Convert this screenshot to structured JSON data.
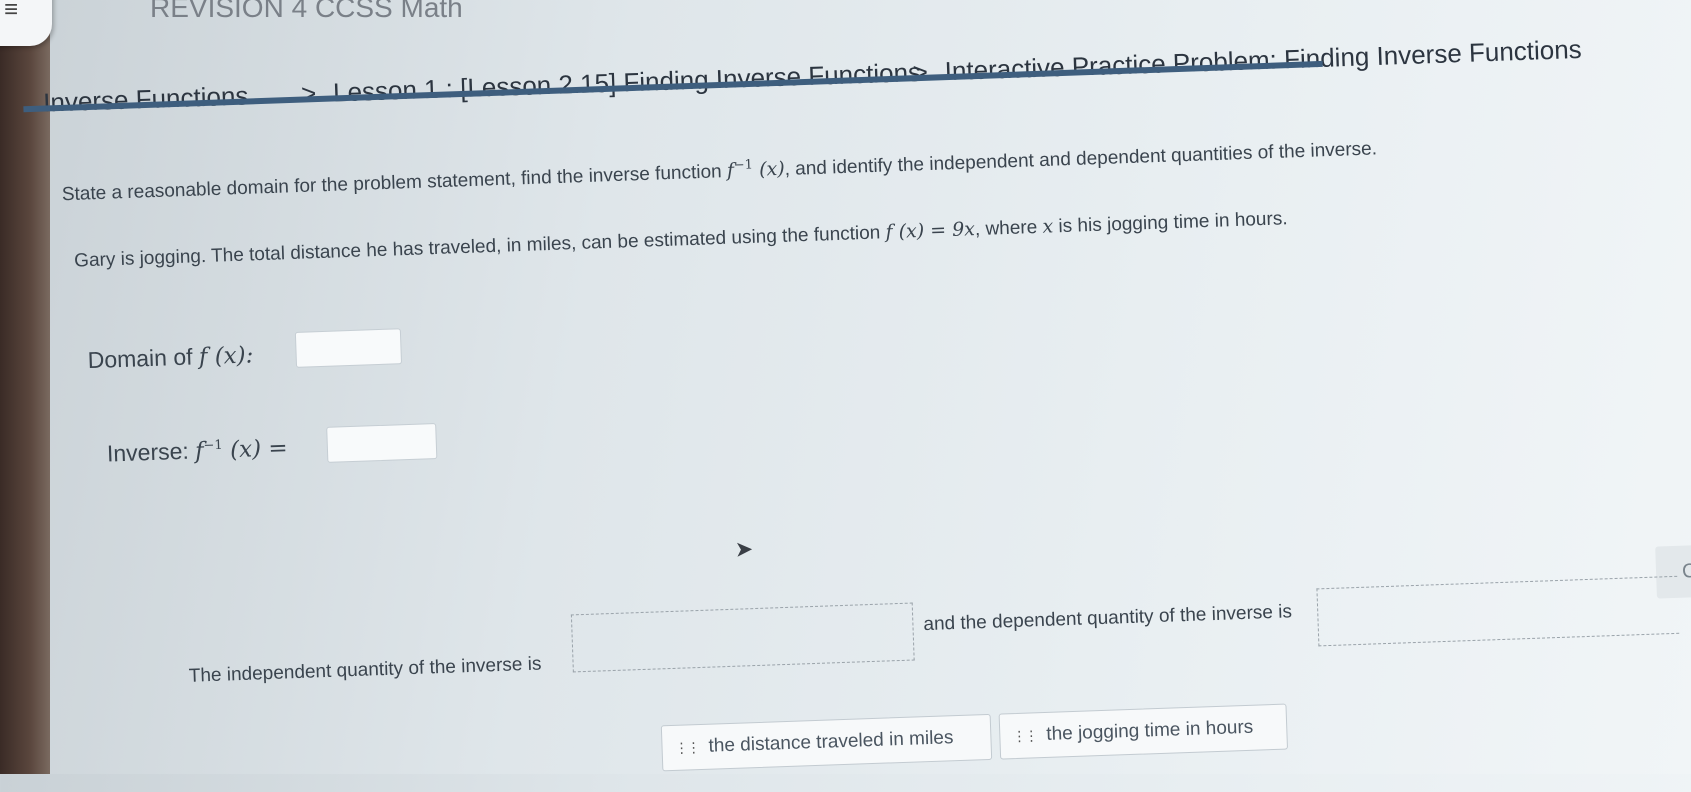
{
  "course_title": "REVISION 4 CCSS Math",
  "breadcrumb": {
    "items": [
      "Inverse Functions",
      "Lesson 1 : [Lesson 2.15] Finding Inverse Functions",
      "Interactive Practice Problem: Finding Inverse Functions"
    ],
    "separator": ">"
  },
  "problem": {
    "instruction_before": "State a reasonable domain for the problem statement, find the inverse function",
    "instruction_func": "f",
    "instruction_sup": "−1",
    "instruction_arg": "(x)",
    "instruction_after": ", and identify the independent and dependent quantities of the inverse.",
    "story_before": "Gary is jogging. The total distance he has traveled, in miles, can be estimated using the function",
    "story_func": "f (x) = 9x",
    "story_mid": ", where",
    "story_var": "x",
    "story_after": "is his jogging time in hours."
  },
  "domain": {
    "label": "Domain of",
    "func": "f (x):",
    "value": ""
  },
  "inverse": {
    "label": "Inverse:",
    "func": "f",
    "sup": "−1",
    "arg": "(x) =",
    "value": ""
  },
  "check_button": "Check A",
  "quantities": {
    "independent_text": "The independent quantity of the inverse is",
    "dependent_text": "and the dependent quantity of the inverse is"
  },
  "choices": [
    "the distance traveled in miles",
    "the jogging time in hours"
  ],
  "icons": {
    "menu": "menu-icon",
    "chevron": "chevron-right-icon",
    "drag_handle": "drag-handle-icon",
    "cursor": "mouse-cursor-icon"
  }
}
